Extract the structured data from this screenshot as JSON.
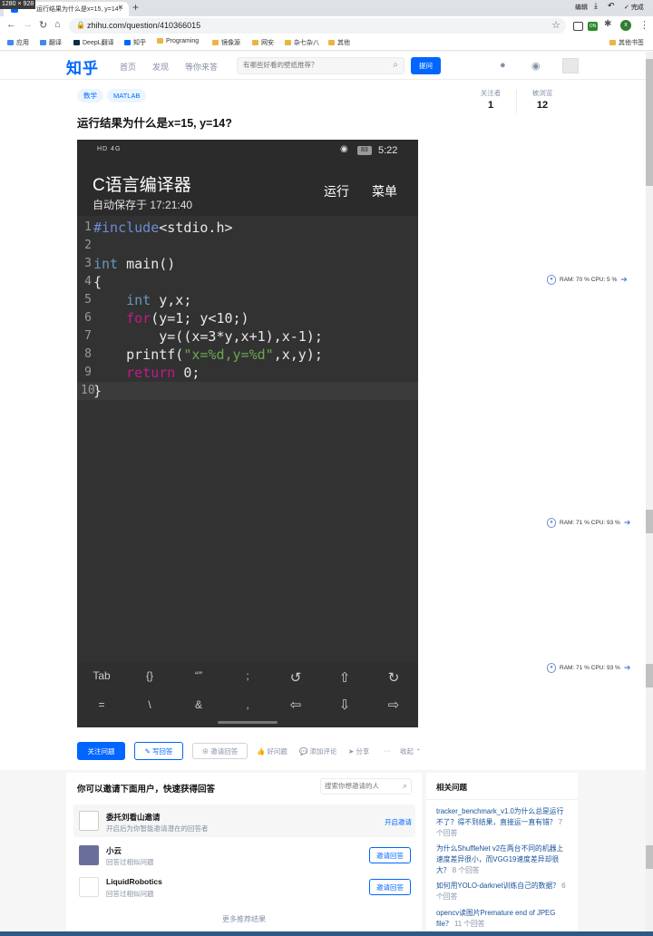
{
  "browser": {
    "dim_badge": "1280 × 928",
    "tab_title": "运行结果为什么是x=15, y=14?",
    "url": "zhihu.com/question/410366015",
    "edit_label": "编辑",
    "done_label": "完成",
    "profile_initial": "x",
    "ext_badge": "ON"
  },
  "bookmarks": {
    "items": [
      "应用",
      "翻译",
      "DeepL翻译",
      "知乎",
      "Programing",
      "镜像源",
      "网安",
      "杂七杂八",
      "其他"
    ],
    "other": "其他书签"
  },
  "zhihu_header": {
    "logo": "知乎",
    "nav": [
      "首页",
      "发现",
      "等你来答"
    ],
    "search_placeholder": "有哪些好看的壁纸推荐？",
    "ask_button": "提问"
  },
  "question": {
    "tags": [
      "数学",
      "MATLAB"
    ],
    "title": "运行结果为什么是x=15, y=14?",
    "followers_label": "关注者",
    "followers_count": "1",
    "views_label": "被浏览",
    "views_count": "12"
  },
  "phone": {
    "network": "HD 4G",
    "battery": "83",
    "time": "5:22",
    "app_title": "C语言编译器",
    "saved_text": "自动保存于 17:21:40",
    "run_label": "运行",
    "menu_label": "菜单",
    "line_numbers": [
      "1",
      "2",
      "3",
      "4",
      "5",
      "6",
      "7",
      "8",
      "9",
      "10"
    ],
    "keys_row1": [
      "Tab",
      "{}",
      "“”",
      ";",
      "↺",
      "⇧",
      "↻"
    ],
    "keys_row2": [
      "=",
      "\\",
      "&",
      ",",
      "⇦",
      "⇩",
      "⇨"
    ]
  },
  "actions": {
    "follow": "关注问题",
    "write": "写回答",
    "invite": "邀请回答",
    "good": "好问题",
    "comment": "添加评论",
    "share": "分享",
    "more": "···",
    "collapse": "收起"
  },
  "monitors": [
    {
      "ram": "RAM: 70 %",
      "cpu": "CPU: 5 %"
    },
    {
      "ram": "RAM: 71 %",
      "cpu": "CPU: 93 %"
    },
    {
      "ram": "RAM: 71 %",
      "cpu": "CPU: 93 %"
    }
  ],
  "invite": {
    "title": "你可以邀请下面用户，快速获得回答",
    "search_placeholder": "搜索你想邀请的人",
    "delegate_name": "委托刘看山邀请",
    "delegate_sub": "开启后为你智能邀请潜在的回答者",
    "delegate_action": "开启邀请",
    "users": [
      {
        "name": "小云",
        "sub": "回答过相似问题",
        "button": "邀请回答"
      },
      {
        "name": "LiquidRobotics",
        "sub": "回答过相似问题",
        "button": "邀请回答"
      }
    ],
    "more": "更多推荐结果"
  },
  "related": {
    "title": "相关问题",
    "items": [
      {
        "q": "tracker_benchmark_v1.0为什么总是运行不了？得不到结果，直接运一直有错？",
        "count": "7 个回答"
      },
      {
        "q": "为什么ShuffleNet v2在两台不同的机器上速度差异很小，而VGG19速度差异却很大？",
        "count": "8 个回答"
      },
      {
        "q": "如何用YOLO-darknet训练自己的数据？",
        "count": "6 个回答"
      },
      {
        "q": "opencv读图片Premature end of JPEG file？",
        "count": "11 个回答"
      }
    ]
  }
}
